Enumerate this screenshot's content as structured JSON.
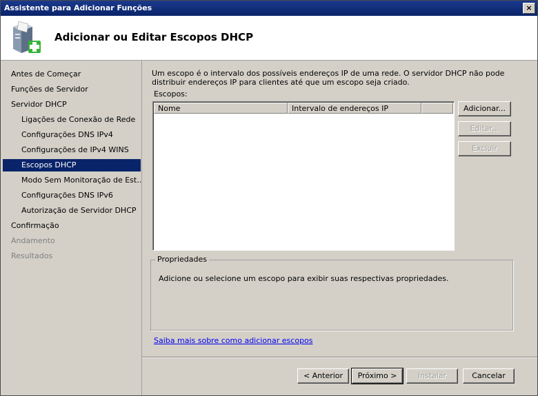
{
  "window": {
    "title": "Assistente para Adicionar Funções",
    "close_label": "×"
  },
  "header": {
    "title": "Adicionar ou Editar Escopos DHCP",
    "icon": "server-add-icon"
  },
  "nav": {
    "items": [
      {
        "label": "Antes de Começar"
      },
      {
        "label": "Funções de Servidor"
      },
      {
        "label": "Servidor DHCP"
      },
      {
        "label": "Ligações de Conexão de Rede"
      },
      {
        "label": "Configurações DNS IPv4"
      },
      {
        "label": "Configurações de IPv4 WINS"
      },
      {
        "label": "Escopos DHCP"
      },
      {
        "label": "Modo Sem Monitoração de Est..."
      },
      {
        "label": "Configurações DNS IPv6"
      },
      {
        "label": "Autorização de Servidor DHCP"
      },
      {
        "label": "Confirmação"
      },
      {
        "label": "Andamento"
      },
      {
        "label": "Resultados"
      }
    ]
  },
  "main": {
    "description": "Um escopo é o intervalo dos possíveis endereços IP de uma rede. O servidor DHCP não pode distribuir endereços IP para clientes até que um escopo seja criado.",
    "scopes_label": "Escopos:",
    "columns": [
      "Nome",
      "Intervalo de endereços IP",
      ""
    ],
    "buttons": {
      "add": "Adicionar...",
      "edit": "Editar...",
      "delete": "Excluir"
    },
    "properties": {
      "title": "Propriedades",
      "text": "Adicione ou selecione um escopo para exibir suas respectivas propriedades."
    },
    "help_link": "Saiba mais sobre como adicionar escopos"
  },
  "footer": {
    "back": "< Anterior",
    "next": "Próximo >",
    "install": "Instalar",
    "cancel": "Cancelar"
  }
}
